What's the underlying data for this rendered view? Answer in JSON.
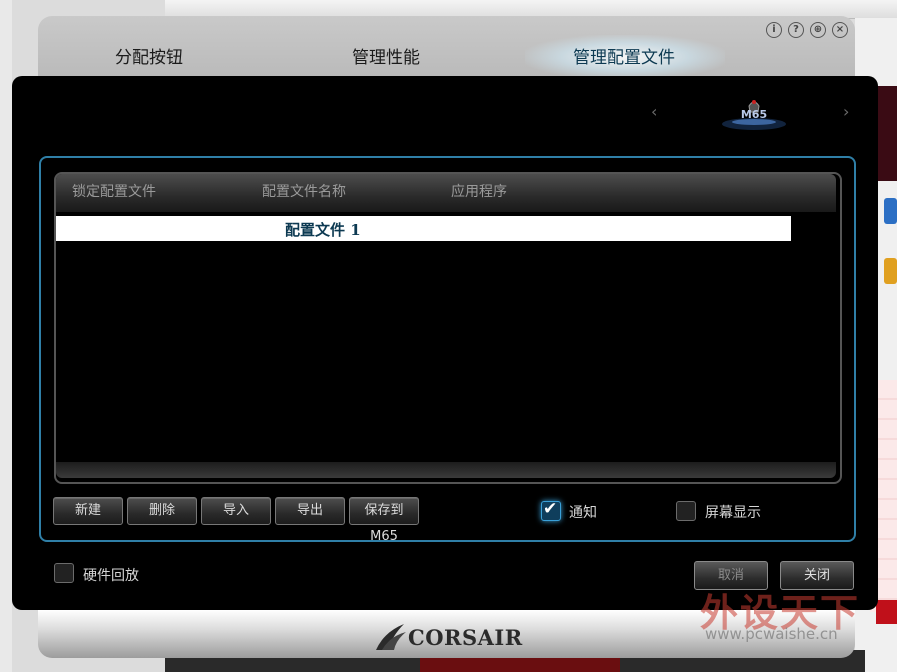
{
  "tabs": [
    {
      "label": "分配按钮"
    },
    {
      "label": "管理性能"
    },
    {
      "label": "管理配置文件",
      "active": true
    }
  ],
  "window_buttons": {
    "info": "i",
    "help": "?",
    "web": "⊕",
    "close": "×"
  },
  "device": {
    "label": "M65",
    "prev": "‹",
    "next": "›"
  },
  "table": {
    "headers": [
      "锁定配置文件",
      "配置文件名称",
      "应用程序"
    ],
    "rows": [
      {
        "name": "配置文件 1",
        "selected": true
      }
    ]
  },
  "buttons": {
    "new": "新建",
    "delete": "删除",
    "import": "导入",
    "export": "导出",
    "save_to": "保存到 M65"
  },
  "options": {
    "notify": {
      "label": "通知",
      "checked": true
    },
    "screen_display": {
      "label": "屏幕显示",
      "checked": false
    },
    "hardware_playback": {
      "label": "硬件回放",
      "checked": false
    }
  },
  "dialog": {
    "cancel": "取消",
    "close": "关闭"
  },
  "brand": "CORSAIR",
  "watermark": {
    "text": "外设天下",
    "url": "www.pcwaishe.cn"
  },
  "colors": {
    "accent": "#2f7fa7",
    "selected_text": "#0d3a52"
  }
}
